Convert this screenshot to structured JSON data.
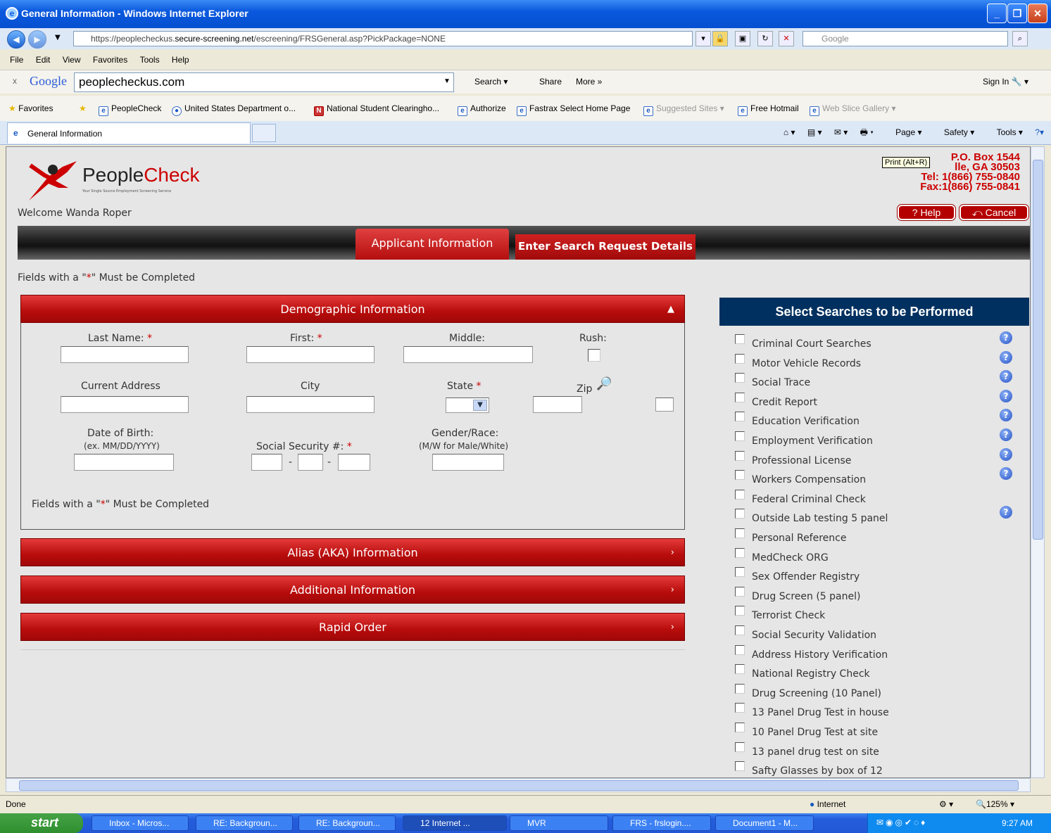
{
  "window": {
    "title": "General Information - Windows Internet Explorer"
  },
  "address": {
    "url_prefix": "https://peoplecheckus.",
    "url_domain": "secure-screening.net",
    "url_path": "/escreening/FRSGeneral.asp?PickPackage=NONE",
    "search_placeholder": "Google"
  },
  "menu": [
    "File",
    "Edit",
    "View",
    "Favorites",
    "Tools",
    "Help"
  ],
  "google_toolbar": {
    "logo": "Google",
    "query": "peoplecheckus.com",
    "search_label": "Search",
    "share_label": "Share",
    "more_label": "More »",
    "signin_label": "Sign In"
  },
  "favorites": {
    "label": "Favorites",
    "items": [
      "PeopleCheck",
      "United States Department o...",
      "National Student Clearingho...",
      "Authorize",
      "Fastrax Select Home Page",
      "Suggested Sites",
      "Free Hotmail",
      "Web Slice Gallery"
    ]
  },
  "tabs": {
    "active": "General Information"
  },
  "commandbar": [
    "Page",
    "Safety",
    "Tools"
  ],
  "page": {
    "logo_main": "People",
    "logo_accent": "Check",
    "logo_tagline": "Your Single Source Employment Screening Service",
    "contact": [
      "P.O. Box 1544",
      "lle, GA 30503",
      "Tel: 1(866) 755-0840",
      "Fax:1(866) 755-0841"
    ],
    "tooltip": "Print (Alt+R)",
    "welcome": "Welcome Wanda Roper",
    "help_label": "? Help",
    "cancel_label": "⤺ Cancel",
    "nav_tabs": [
      "Applicant Information",
      "Enter Search Request Details"
    ],
    "required_note": "Fields with a \"*\" Must be Completed",
    "required_note_start": "Fields with a \"",
    "required_note_star": "*",
    "required_note_end": "\" Must be Completed",
    "sections": {
      "demographic": "Demographic Information",
      "alias": "Alias (AKA) Information",
      "additional": "Additional Information",
      "rapid": "Rapid Order"
    },
    "fields": {
      "last_name": "Last Name:",
      "first": "First:",
      "middle": "Middle:",
      "rush": "Rush:",
      "current_address": "Current Address",
      "city": "City",
      "state": "State",
      "zip": "Zip",
      "dob": "Date of Birth:",
      "dob_hint": "(ex. MM/DD/YYYY)",
      "ssn": "Social Security #:",
      "gender": "Gender/Race:",
      "gender_hint": "(M/W for Male/White)",
      "star": "*",
      "dash": "-"
    },
    "search_panel": {
      "title": "Select Searches to be Performed",
      "items": [
        "Criminal Court Searches",
        "Motor Vehicle Records",
        "Social Trace",
        "Credit Report",
        "Education Verification",
        "Employment Verification",
        "Professional License",
        "Workers Compensation",
        "Federal Criminal Check",
        "Outside Lab testing 5 panel",
        "Personal Reference",
        "MedCheck ORG",
        "Sex Offender Registry",
        "Drug Screen (5 panel)",
        "Terrorist Check",
        "Social Security Validation",
        "Address History Verification",
        "National Registry Check",
        "Drug Screening (10 Panel)",
        "13 Panel Drug Test in house",
        "10 Panel Drug Test at site",
        "13 panel drug test on site",
        "Safty Glasses by box of 12"
      ]
    }
  },
  "status": {
    "left": "Done",
    "zone": "Internet",
    "zoom": "125%"
  },
  "taskbar": {
    "start": "start",
    "items": [
      "Inbox - Micros...",
      "RE: Backgroun...",
      "RE: Backgroun...",
      "12 Internet ...",
      "MVR",
      "FRS - frslogin....",
      "Document1 - M..."
    ],
    "clock": "9:27 AM"
  }
}
